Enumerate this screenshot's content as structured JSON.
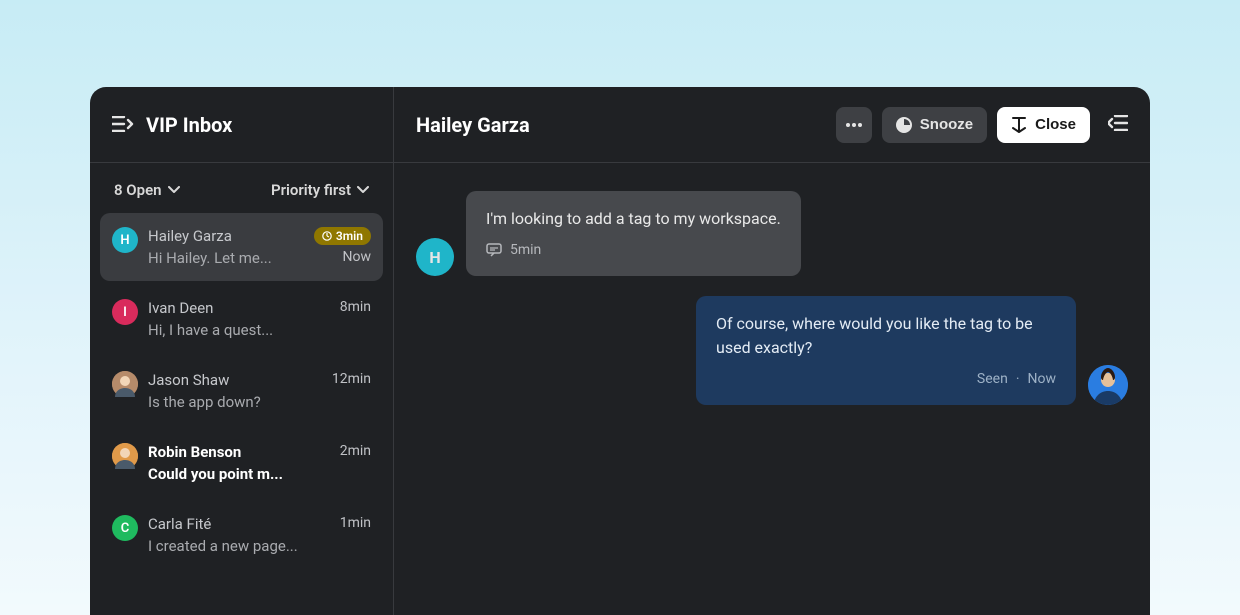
{
  "sidebar": {
    "title": "VIP Inbox",
    "open_filter": "8 Open",
    "sort_filter": "Priority first"
  },
  "conversations": [
    {
      "initial": "H",
      "color": "#1fb5c9",
      "name": "Hailey Garza",
      "preview": "Hi Hailey. Let me...",
      "badge": "3min",
      "time": "Now",
      "active": true,
      "bold": false,
      "photo": false
    },
    {
      "initial": "I",
      "color": "#d92b5c",
      "name": "Ivan Deen",
      "preview": "Hi, I have a quest...",
      "badge": "",
      "time": "8min",
      "active": false,
      "bold": false,
      "photo": false
    },
    {
      "initial": "",
      "color": "#b68b6a",
      "name": "Jason Shaw",
      "preview": "Is the app down?",
      "badge": "",
      "time": "12min",
      "active": false,
      "bold": false,
      "photo": true
    },
    {
      "initial": "",
      "color": "#e09a4a",
      "name": "Robin Benson",
      "preview": "Could you point m...",
      "badge": "",
      "time": "2min",
      "active": false,
      "bold": true,
      "photo": true
    },
    {
      "initial": "C",
      "color": "#1fba5f",
      "name": "Carla Fité",
      "preview": "I created a new page...",
      "badge": "",
      "time": "1min",
      "active": false,
      "bold": false,
      "photo": false
    }
  ],
  "main": {
    "title": "Hailey Garza",
    "snooze_label": "Snooze",
    "close_label": "Close"
  },
  "thread": {
    "incoming": {
      "avatar_initial": "H",
      "avatar_color": "#1fb5c9",
      "text": "I'm looking to add a tag to my workspace.",
      "meta_time": "5min"
    },
    "outgoing": {
      "text": "Of course, where would you like the tag to be used exactly?",
      "status": "Seen",
      "dot": "·",
      "time": "Now"
    }
  }
}
